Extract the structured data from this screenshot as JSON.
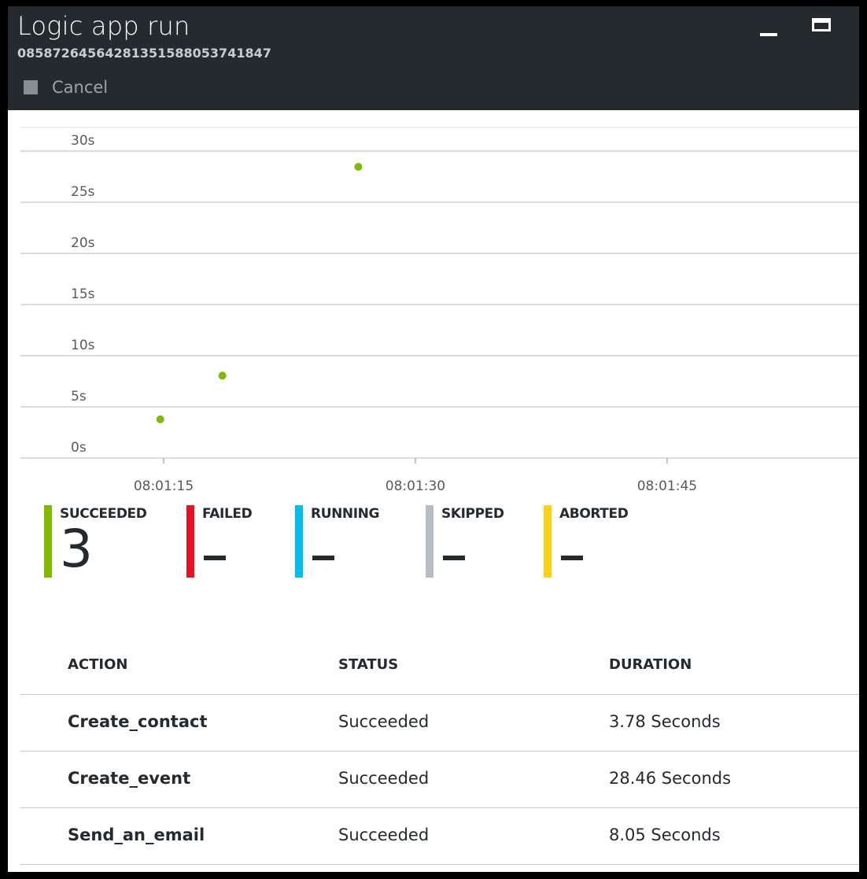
{
  "header": {
    "title": "Logic app run",
    "run_id": "08587264564281351588053741847",
    "cancel_label": "Cancel"
  },
  "window_controls": [
    "minimize-icon",
    "maximize-icon"
  ],
  "chart_data": {
    "type": "scatter",
    "y_ticks": [
      "30s",
      "25s",
      "20s",
      "15s",
      "10s",
      "5s",
      "0s"
    ],
    "ylim": [
      0,
      32
    ],
    "x_ticks": [
      "08:01:15",
      "08:01:30",
      "08:01:45"
    ],
    "xlim_seconds_from_tick_start": [
      -8.5,
      40.5
    ],
    "points": [
      {
        "x": "08:01:14.8",
        "y": 3.78,
        "label": "Create_contact"
      },
      {
        "x": "08:01:18.5",
        "y": 8.05,
        "label": "Send_an_email"
      },
      {
        "x": "08:01:26.6",
        "y": 28.46,
        "label": "Create_event"
      }
    ],
    "point_color": "#7fba00",
    "grid": true
  },
  "status_summary": [
    {
      "label": "SUCCEEDED",
      "value": "3",
      "color": "#7fba00"
    },
    {
      "label": "FAILED",
      "value": "–",
      "color": "#e81123"
    },
    {
      "label": "RUNNING",
      "value": "–",
      "color": "#00bcf2"
    },
    {
      "label": "SKIPPED",
      "value": "–",
      "color": "#b7bdc6"
    },
    {
      "label": "ABORTED",
      "value": "–",
      "color": "#fcd116"
    }
  ],
  "table": {
    "columns": [
      "ACTION",
      "STATUS",
      "DURATION"
    ],
    "rows": [
      [
        "Create_contact",
        "Succeeded",
        "3.78 Seconds"
      ],
      [
        "Create_event",
        "Succeeded",
        "28.46 Seconds"
      ],
      [
        "Send_an_email",
        "Succeeded",
        "8.05 Seconds"
      ]
    ]
  }
}
